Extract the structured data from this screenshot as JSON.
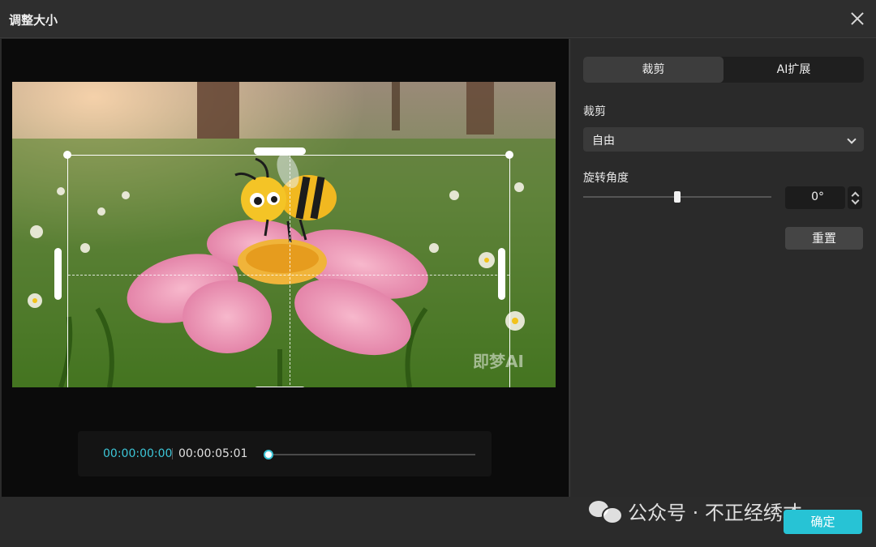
{
  "dialog": {
    "title": "调整大小"
  },
  "preview": {
    "image_description": "bee-on-pink-flower",
    "image_watermark": "即梦AI"
  },
  "timeline": {
    "current_time": "00:00:00:00",
    "total_time": "00:00:05:01",
    "progress": 0.0
  },
  "sidebar": {
    "tabs": [
      {
        "label": "裁剪",
        "active": true
      },
      {
        "label": "AI扩展",
        "active": false
      }
    ],
    "crop_label": "裁剪",
    "crop_select": {
      "value": "自由"
    },
    "rotation_label": "旋转角度",
    "rotation_value": "0°",
    "rotation_slider": 0.5,
    "reset_label": "重置"
  },
  "footer": {
    "confirm_label": "确定",
    "watermark_text": "公众号 · 不正经绣才"
  },
  "colors": {
    "accent": "#27c3d5",
    "timecode": "#3cc6d8"
  }
}
